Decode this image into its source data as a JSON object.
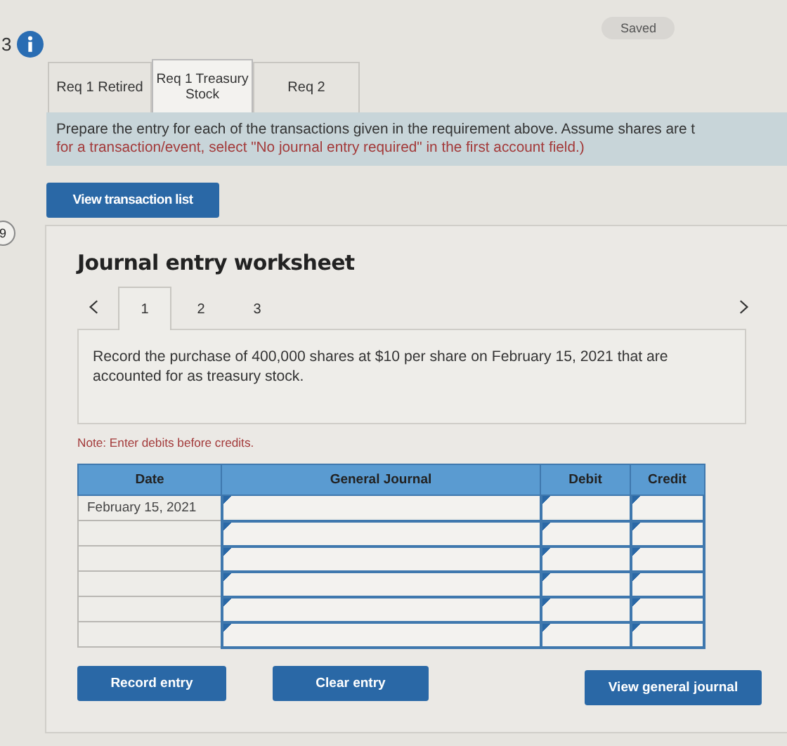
{
  "header": {
    "question_number": "3",
    "status": "Saved"
  },
  "tabs": [
    {
      "label": "Req 1 Retired",
      "selected": false
    },
    {
      "label": "Req 1 Treasury Stock",
      "selected": true
    },
    {
      "label": "Req 2",
      "selected": false
    }
  ],
  "instructions": [
    {
      "kind": "plain",
      "text": "Prepare the entry for each of the transactions given in the requirement above. Assume shares are t"
    },
    {
      "kind": "note",
      "text": "for a transaction/event, select \"No journal entry required\" in the first account field.)"
    }
  ],
  "transaction_list_button": "View transaction list",
  "worksheet": {
    "side_badge": "9",
    "title": "Journal entry worksheet",
    "steps": [
      {
        "label": "1",
        "selected": true
      },
      {
        "label": "2",
        "selected": false
      },
      {
        "label": "3",
        "selected": false
      }
    ],
    "description": "Record the purchase of 400,000 shares at $10 per share on February 15, 2021 that are accounted for as treasury stock.",
    "note": "Note: Enter debits before credits.",
    "columns": [
      "Date",
      "General Journal",
      "Debit",
      "Credit"
    ],
    "rows": [
      {
        "date": "February 15, 2021"
      },
      {},
      {},
      {},
      {},
      {}
    ],
    "buttons": [
      "Record entry",
      "Clear entry",
      "View general journal"
    ]
  }
}
